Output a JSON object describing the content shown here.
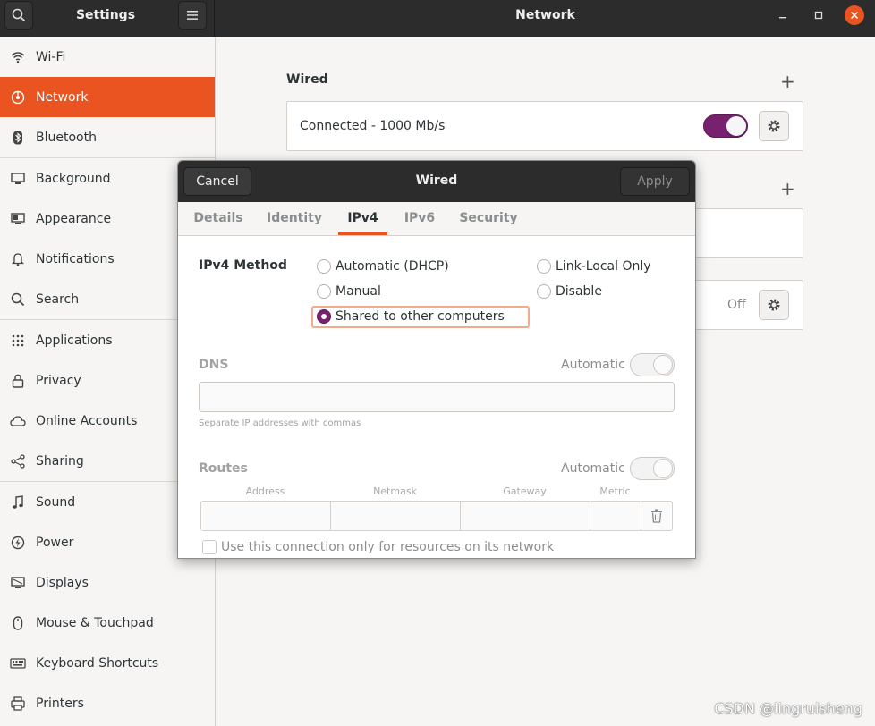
{
  "header": {
    "app_title": "Settings",
    "page_title": "Network",
    "icons": {
      "search": "search-icon",
      "menu": "hamburger-menu-icon",
      "minimize": "minimize-icon",
      "maximize": "maximize-icon",
      "close": "close-icon"
    }
  },
  "sidebar": {
    "items": [
      {
        "label": "Wi-Fi",
        "icon": "wifi-icon"
      },
      {
        "label": "Network",
        "icon": "network-icon",
        "active": true
      },
      {
        "label": "Bluetooth",
        "icon": "bluetooth-icon"
      },
      {
        "label": "Background",
        "icon": "background-icon"
      },
      {
        "label": "Appearance",
        "icon": "appearance-icon"
      },
      {
        "label": "Notifications",
        "icon": "bell-icon"
      },
      {
        "label": "Search",
        "icon": "search-icon"
      },
      {
        "label": "Applications",
        "icon": "applications-grid-icon"
      },
      {
        "label": "Privacy",
        "icon": "lock-icon"
      },
      {
        "label": "Online Accounts",
        "icon": "cloud-icon"
      },
      {
        "label": "Sharing",
        "icon": "share-icon"
      },
      {
        "label": "Sound",
        "icon": "music-note-icon"
      },
      {
        "label": "Power",
        "icon": "power-icon"
      },
      {
        "label": "Displays",
        "icon": "display-icon"
      },
      {
        "label": "Mouse & Touchpad",
        "icon": "mouse-icon"
      },
      {
        "label": "Keyboard Shortcuts",
        "icon": "keyboard-icon"
      },
      {
        "label": "Printers",
        "icon": "printer-icon"
      }
    ]
  },
  "main": {
    "wired_section_title": "Wired",
    "wired_status": "Connected - 1000 Mb/s",
    "wired_toggle": true,
    "other_status": "Off"
  },
  "dialog": {
    "title": "Wired",
    "cancel_label": "Cancel",
    "apply_label": "Apply",
    "tabs": [
      "Details",
      "Identity",
      "IPv4",
      "IPv6",
      "Security"
    ],
    "active_tab": "IPv4",
    "ipv4_method_label": "IPv4 Method",
    "methods": {
      "automatic": "Automatic (DHCP)",
      "link_local": "Link-Local Only",
      "manual": "Manual",
      "disable": "Disable",
      "shared": "Shared to other computers"
    },
    "selected_method": "Shared to other computers",
    "dns_label": "DNS",
    "dns_auto_label": "Automatic",
    "dns_value": "",
    "dns_hint": "Separate IP addresses with commas",
    "routes_label": "Routes",
    "routes_auto_label": "Automatic",
    "route_columns": [
      "Address",
      "Netmask",
      "Gateway",
      "Metric"
    ],
    "only_resources_label": "Use this connection only for resources on its network"
  },
  "watermark": "CSDN @lingruisheng",
  "colors": {
    "accent": "#e95420",
    "toggle_on": "#77216f",
    "header": "#2c2c2c"
  }
}
